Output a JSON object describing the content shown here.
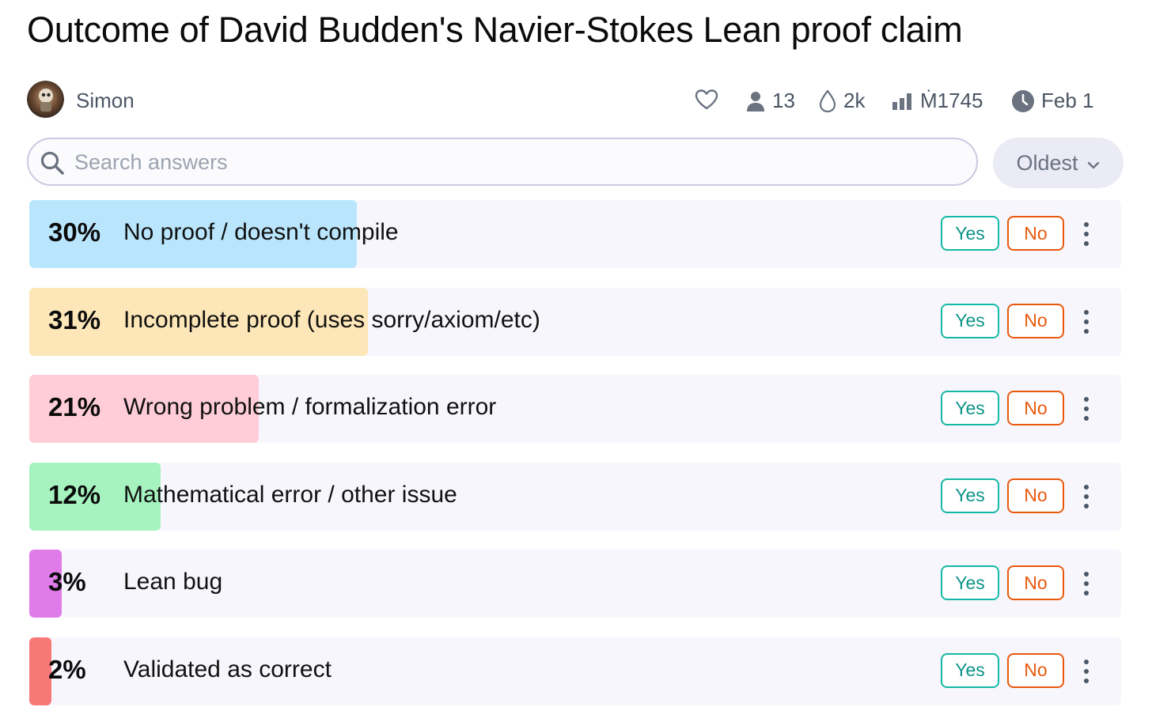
{
  "title": "Outcome of David Budden's Navier-Stokes Lean proof claim",
  "creator": {
    "name": "Simon"
  },
  "stats": {
    "traders": "13",
    "volume": "2k",
    "mana": "Ṁ1745",
    "date": "Feb 1"
  },
  "search": {
    "placeholder": "Search answers"
  },
  "sort": {
    "label": "Oldest"
  },
  "buttons": {
    "yes": "Yes",
    "no": "No"
  },
  "answers": [
    {
      "percent_label": "30%",
      "percent": 30,
      "text": "No proof / doesn't compile",
      "color": "#bae6fd"
    },
    {
      "percent_label": "31%",
      "percent": 31,
      "text": "Incomplete proof (uses sorry/axiom/etc)",
      "color": "#fde7b8"
    },
    {
      "percent_label": "21%",
      "percent": 21,
      "text": "Wrong problem / formalization error",
      "color": "#fecdd8"
    },
    {
      "percent_label": "12%",
      "percent": 12,
      "text": "Mathematical error / other issue",
      "color": "#a7f3c0"
    },
    {
      "percent_label": "3%",
      "percent": 3,
      "text": "Lean bug",
      "color": "#e07bea"
    },
    {
      "percent_label": "2%",
      "percent": 2,
      "text": "Validated as correct",
      "color": "#f87878"
    }
  ]
}
